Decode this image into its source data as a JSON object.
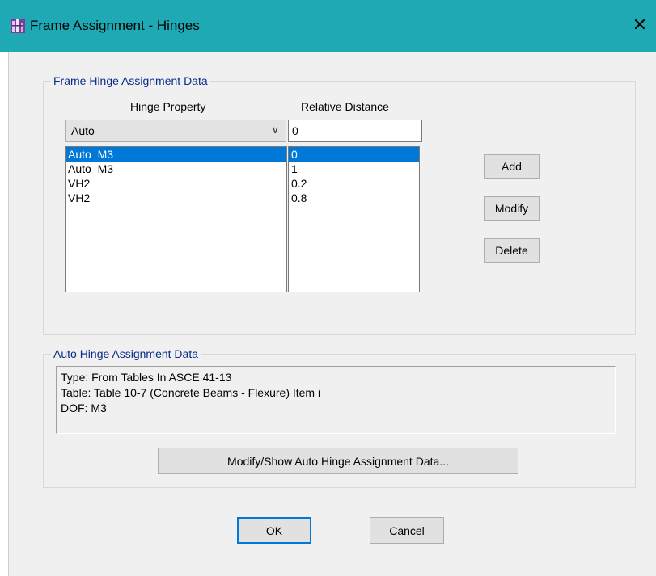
{
  "window": {
    "title": "Frame Assignment - Hinges",
    "app_icon": "etabs-app-icon",
    "close_glyph": "✕"
  },
  "frame_hinge": {
    "legend": "Frame Hinge Assignment Data",
    "hinge_property_header": "Hinge Property",
    "relative_distance_header": "Relative Distance",
    "hinge_property_value": "Auto",
    "relative_distance_value": "0",
    "hinge_list": [
      {
        "property": "Auto  M3",
        "distance": "0",
        "selected": true
      },
      {
        "property": "Auto  M3",
        "distance": "1",
        "selected": false
      },
      {
        "property": "VH2",
        "distance": "0.2",
        "selected": false
      },
      {
        "property": "VH2",
        "distance": "0.8",
        "selected": false
      }
    ],
    "add_label": "Add",
    "modify_label": "Modify",
    "delete_label": "Delete"
  },
  "auto_hinge": {
    "legend": "Auto Hinge Assignment Data",
    "lines": [
      "Type:  From Tables In ASCE 41-13",
      "Table:  Table 10-7 (Concrete Beams - Flexure) Item i",
      "DOF:  M3"
    ],
    "modify_show_label": "Modify/Show Auto Hinge Assignment Data..."
  },
  "footer": {
    "ok_label": "OK",
    "cancel_label": "Cancel"
  },
  "colors": {
    "titlebar": "#1ea9b5",
    "selection": "#0078d7",
    "group_label": "#0a2a8a"
  }
}
